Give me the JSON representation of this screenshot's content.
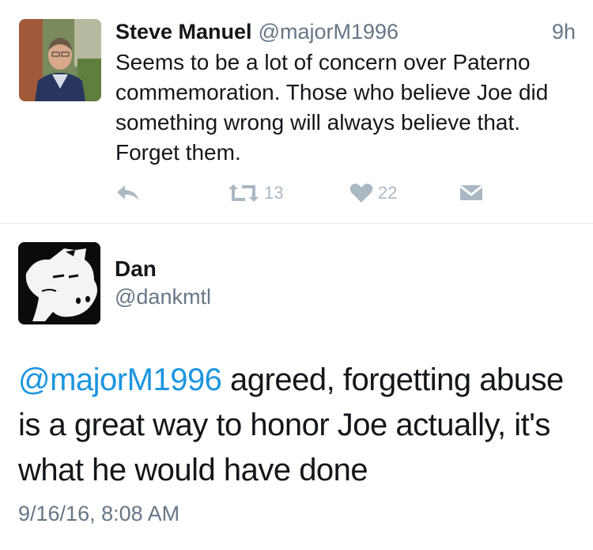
{
  "tweet": {
    "author_name": "Steve Manuel",
    "author_handle": "@majorM1996",
    "time": "9h",
    "text": "Seems to be a lot of concern over Paterno commemoration. Those who believe Joe did something wrong will always believe that. Forget them.",
    "retweet_count": "13",
    "like_count": "22",
    "icons": [
      "reply-icon",
      "retweet-icon",
      "heart-icon",
      "envelope-icon"
    ]
  },
  "reply": {
    "author_name": "Dan",
    "author_handle": "@dankmtl",
    "mention": "@majorM1996",
    "text": " agreed, forgetting abuse is a great way to honor Joe actually, it's what he would have done",
    "timestamp": "9/16/16, 8:08 AM"
  },
  "colors": {
    "link": "#1b95e0",
    "secondary_text": "#657786",
    "action_icons": "#aab8c2",
    "divider": "#e1e8ed"
  }
}
